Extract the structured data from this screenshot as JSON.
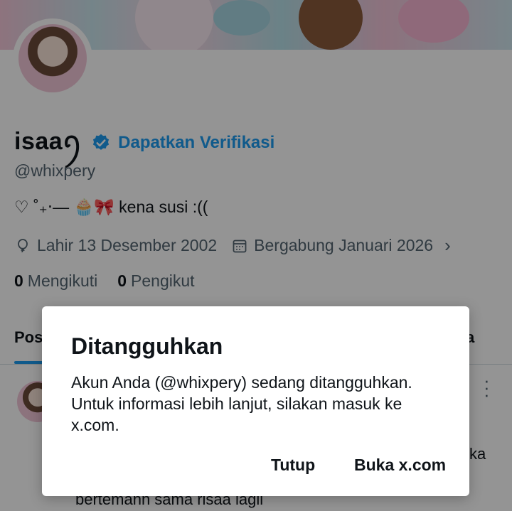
{
  "profile": {
    "display_name": "isaaꪆ",
    "verify_link": "Dapatkan Verifikasi",
    "handle": "@whixpery",
    "bio": "♡ ˚₊‧— 🧁🎀 kena susi :((",
    "birth": "Lahir 13 Desember 2002",
    "joined": "Bergabung Januari 2026",
    "following_count": "0",
    "following_label": "Mengikuti",
    "followers_count": "0",
    "followers_label": "Pengikut"
  },
  "tabs": {
    "first_partial": "Pos",
    "last_partial": "a"
  },
  "post": {
    "text_tail": "ka",
    "text_bottom": "bertemann sama risaa lagii"
  },
  "dialog": {
    "title": "Ditangguhkan",
    "body": "Akun Anda (@whixpery) sedang ditangguhkan. Untuk informasi lebih lanjut, silakan masuk ke x.com.",
    "close_label": "Tutup",
    "open_label": "Buka x.com"
  },
  "colors": {
    "accent": "#1d9bf0",
    "text": "#0f1419",
    "muted": "#536471"
  },
  "icons": {
    "verified": "verified-badge-icon",
    "birth": "balloon-icon",
    "calendar": "calendar-icon",
    "chevron": "chevron-right-icon",
    "more": "more-vertical-icon"
  }
}
